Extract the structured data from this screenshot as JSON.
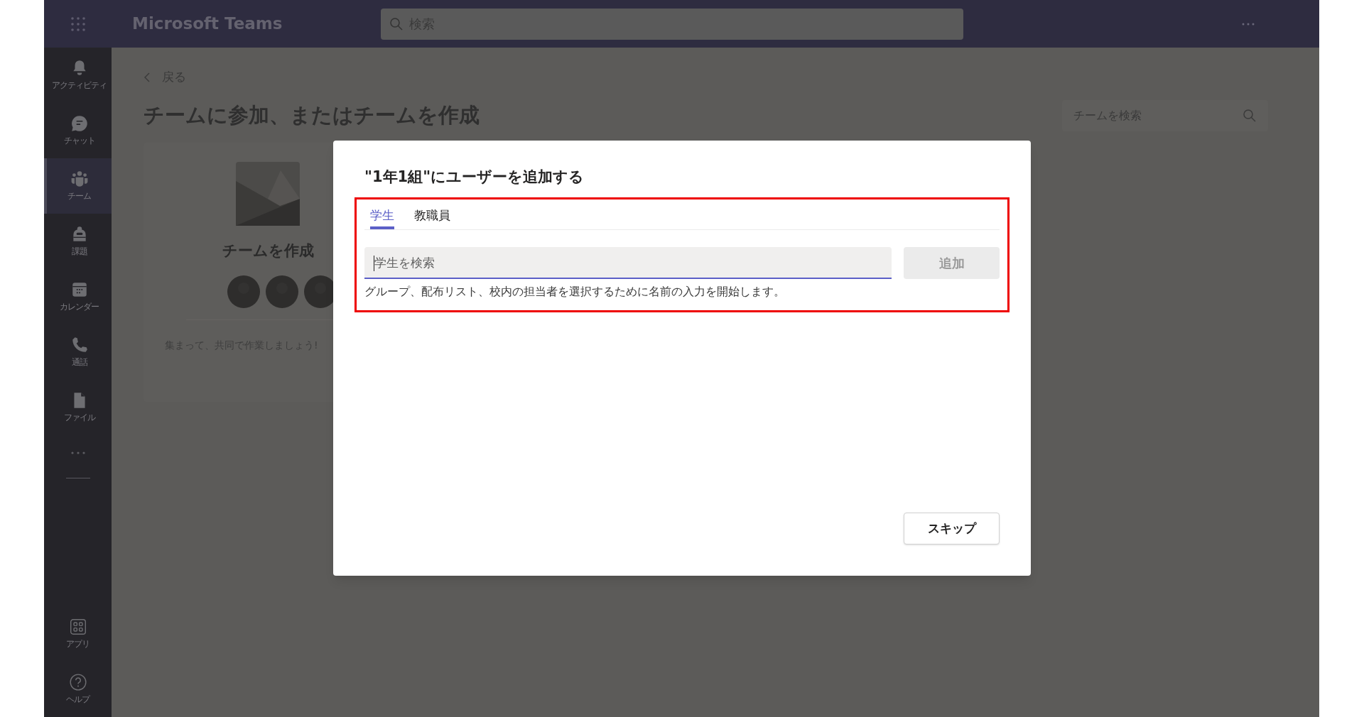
{
  "app_bar": {
    "title": "Microsoft Teams",
    "search": {
      "placeholder": "検索"
    }
  },
  "sidebar": {
    "items": [
      {
        "kind": "bell",
        "label": "アクティビティ",
        "selected": false
      },
      {
        "kind": "chat",
        "label": "チャット",
        "selected": false
      },
      {
        "kind": "teams",
        "label": "チーム",
        "selected": true
      },
      {
        "kind": "assignment",
        "label": "課題",
        "selected": false
      },
      {
        "kind": "calendar",
        "label": "カレンダー",
        "selected": false
      },
      {
        "kind": "phone",
        "label": "通話",
        "selected": false
      },
      {
        "kind": "file",
        "label": "ファイル",
        "selected": false
      }
    ],
    "bottom_items": [
      {
        "kind": "apps",
        "label": "アプリ"
      },
      {
        "kind": "help",
        "label": "ヘルプ"
      }
    ]
  },
  "page": {
    "back": "戻る",
    "title": "チームに参加、またはチームを作成",
    "team_search": {
      "placeholder": "チームを検索"
    },
    "card": {
      "title": "チームを作成",
      "text": "集まって、共同で作業しましょう!"
    }
  },
  "dialog": {
    "title": "\"1年1組\"にユーザーを追加する",
    "tabs": [
      {
        "label": "学生",
        "selected": true
      },
      {
        "label": "教職員",
        "selected": false
      }
    ],
    "search": {
      "placeholder": "学生を検索"
    },
    "add_button": {
      "label": "追加",
      "disabled": true
    },
    "hint": "グループ、配布リスト、校内の担当者を選択するために名前の入力を開始します。",
    "skip_button": {
      "label": "スキップ"
    }
  }
}
